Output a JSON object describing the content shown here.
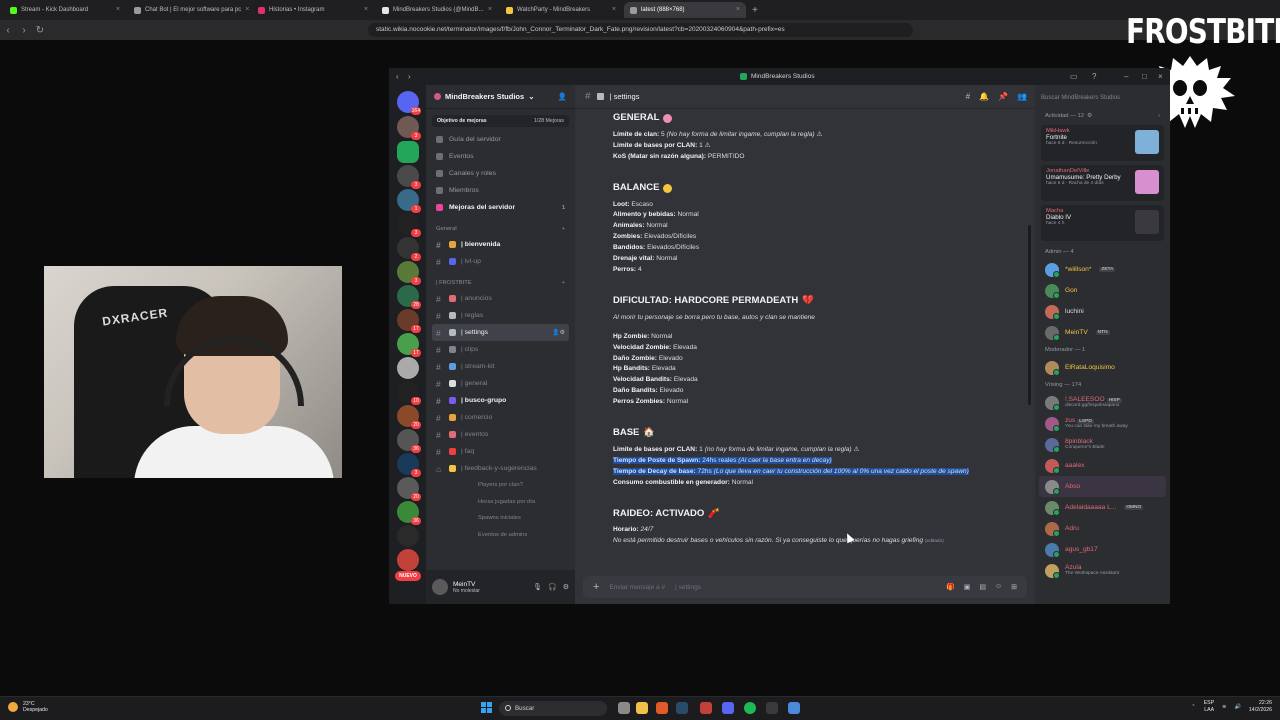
{
  "browser": {
    "tabs": [
      {
        "label": "Stream - Kick Dashboard",
        "color": "#53fc18"
      },
      {
        "label": "Chat Bot | El mejor software para pc",
        "color": "#9b9b9b"
      },
      {
        "label": "Historias • Instagram",
        "color": "#e1306c"
      },
      {
        "label": "MindBreakers Studios (@MindB...",
        "color": "#e6e6e6"
      },
      {
        "label": "WatchParty - MindBreakers",
        "color": "#f5c542"
      },
      {
        "label": "latest (888×768)",
        "color": "#9b9b9b"
      }
    ],
    "url": "static.wikia.nocookie.net/terminator/images/f/fb/John_Connor_Terminator_Dark_Fate.png/revision/latest?cb=20200324060904&path-prefix=es"
  },
  "overlay": {
    "brand": "FROSTBITE"
  },
  "webcam": {
    "chair_text": "DXRACER"
  },
  "discord": {
    "window_title": "MindBreakers Studios",
    "server_name": "MindBreakers Studios",
    "guild_badges": [
      "164",
      "3",
      "3",
      "1",
      "3",
      "2",
      "3",
      "28",
      "17",
      "17",
      "10",
      "20",
      "36",
      "3",
      "20",
      "36"
    ],
    "nuevo_label": "NUEVO",
    "boost": {
      "label": "Objetivo de mejoras",
      "value": "1/28 Mejoras"
    },
    "nav": [
      {
        "label": "Guía del servidor",
        "bold": false
      },
      {
        "label": "Eventos",
        "bold": false
      },
      {
        "label": "Canales y roles",
        "bold": false
      },
      {
        "label": "Miembros",
        "bold": false
      },
      {
        "label": "Mejoras del servidor",
        "bold": true,
        "count": "1"
      }
    ],
    "category_general": "General",
    "category_frostbite": "| FROSTBITE",
    "channels_general": [
      {
        "label": "| bienvenida",
        "unread": true,
        "emoji": "#e6a23c"
      },
      {
        "label": "| lvl-up",
        "unread": false,
        "emoji": "#5865f2"
      }
    ],
    "channels_frostbite": [
      {
        "label": "| anuncios",
        "unread": false,
        "emoji": "#e06c75"
      },
      {
        "label": "| reglas",
        "unread": false,
        "emoji": "#b5bac1"
      },
      {
        "label": "| settings",
        "unread": false,
        "active": true,
        "emoji": "#b5bac1"
      },
      {
        "label": "| clips",
        "unread": false,
        "emoji": "#80848e"
      },
      {
        "label": "| stream-kit",
        "unread": false,
        "emoji": "#5aa0e0"
      },
      {
        "label": "| general",
        "unread": false,
        "emoji": "#dbdee1"
      },
      {
        "label": "| busco-grupo",
        "unread": true,
        "emoji": "#7a5af0"
      },
      {
        "label": "| comercio",
        "unread": false,
        "emoji": "#e6a23c"
      },
      {
        "label": "| eventos",
        "unread": false,
        "emoji": "#e06c75"
      },
      {
        "label": "| faq",
        "unread": false,
        "emoji": "#f23f43"
      },
      {
        "label": "| feedback-y-sugerencias",
        "unread": false,
        "emoji": "#f5c542"
      }
    ],
    "threads": [
      "Players por clan?",
      "Horas jugadas por día",
      "Spawns iniciales",
      "Eventos de admins"
    ],
    "user": {
      "name": "MeinTV",
      "status": "No molestar"
    },
    "channel_header": "| settings",
    "composer_placeholder": "Enviar mensaje a #",
    "composer_channel": "| settings",
    "sections": {
      "general": {
        "title": "GENERAL",
        "lines": [
          {
            "label": "Límite de clan:",
            "value": "5",
            "note": "(No hay forma de limitar ingame, cumplan la regla)"
          },
          {
            "label": "Límite de bases por CLAN:",
            "value": "1"
          },
          {
            "label": "KoS (Matar sin razón alguna):",
            "value": "PERMITIDO"
          }
        ]
      },
      "balance": {
        "title": "BALANCE",
        "lines": [
          {
            "label": "Loot:",
            "value": "Escaso"
          },
          {
            "label": "Alimento y bebidas:",
            "value": "Normal"
          },
          {
            "label": "Animales:",
            "value": "Normal"
          },
          {
            "label": "Zombies:",
            "value": "Elevados/Difíciles"
          },
          {
            "label": "Bandidos:",
            "value": "Elevados/Difíciles"
          },
          {
            "label": "Drenaje vital:",
            "value": "Normal"
          },
          {
            "label": "Perros:",
            "value": "4"
          }
        ]
      },
      "dificultad": {
        "title": "DIFICULTAD: HARDCORE PERMADEATH",
        "subtitle": "Al morir tu personaje se borra pero tu base, autos y clan se mantiene",
        "lines": [
          {
            "label": "Hp Zombie:",
            "value": "Normal"
          },
          {
            "label": "Velocidad Zombie:",
            "value": "Elevada"
          },
          {
            "label": "Daño Zombie:",
            "value": "Elevado"
          },
          {
            "label": "Hp Bandits:",
            "value": "Elevada"
          },
          {
            "label": "Velocidad Bandits:",
            "value": "Elevada"
          },
          {
            "label": "Daño Bandits:",
            "value": "Elevado"
          },
          {
            "label": "Perros Zombies:",
            "value": "Normal"
          }
        ]
      },
      "base": {
        "title": "BASE",
        "lines": [
          {
            "label": "Limite de bases por CLAN:",
            "value": "1",
            "note": "(no hay forma de limitar ingame, cumplan la regla)"
          },
          {
            "label": "Tiempo de Poste de Spawn:",
            "value": "24hs reales",
            "note": "(Al caer la base entra en decay)",
            "selected": true
          },
          {
            "label": "Tiempo de Decay de base:",
            "value": "72hs",
            "note": "(Lo que lleva en caer tu construcción del 100% al 0% una vez caido el poste de spawn)",
            "selected": true
          },
          {
            "label": "Consumo combustible en generador:",
            "value": "Normal"
          }
        ]
      },
      "raideo": {
        "title": "RAIDEO: ACTIVADO",
        "lines": [
          {
            "label": "Horario:",
            "value": "24/7"
          }
        ],
        "note": "No está permitido destruir bases o vehículos sin razón. Si ya conseguiste lo que querías no hagas griefing",
        "edited": "(editado)"
      }
    },
    "members": {
      "search_placeholder": "Buscar MindBreakers Studios",
      "activity_header": "Actividad — 12",
      "activities": [
        {
          "name": "MikHawk",
          "game": "Fortnite",
          "status": "hace 6 d · Resurrección",
          "thumb": "#7fb0d8"
        },
        {
          "name": "JonathanDelVille",
          "game": "Umamusume: Pretty Derby",
          "status": "hace 6 d · Racha de 4 días",
          "thumb": "#d88fd0"
        },
        {
          "name": "Macha",
          "game": "Diablo IV",
          "status": "hace 4 h",
          "thumb": "#3a3a3e"
        }
      ],
      "groups": [
        {
          "header": "Admin — 4",
          "items": [
            {
              "name": "*wiillson*",
              "tag": "ZETA",
              "color": "#f5c542",
              "ava": "#5aa0e0"
            },
            {
              "name": "Gon",
              "color": "#f5c542",
              "ava": "#4a8a5a"
            },
            {
              "name": "luchini",
              "color": "#dbdee1",
              "ava": "#c26a5a"
            },
            {
              "name": "MeinTV",
              "tag": "NTN",
              "color": "#f5c542",
              "ava": "#6a6a6a"
            }
          ]
        },
        {
          "header": "Moderador — 1",
          "items": [
            {
              "name": "ElRataLoquisimo",
              "color": "#f5c542",
              "ava": "#b08a5a"
            }
          ]
        },
        {
          "header": "Vrising — 174",
          "items": [
            {
              "name": "!.SALEESOO",
              "tag": "HISP",
              "sub": "discord.gg/hispahsiapano",
              "color": "#e06c75",
              "ava": "#7a7a7a"
            },
            {
              "name": "zus",
              "tag": "LSPD",
              "sub": "You can take my breath away.",
              "color": "#e06c75",
              "ava": "#a05a8a"
            },
            {
              "name": "8pinblack",
              "sub": "Conqueror's Blade",
              "color": "#e06c75",
              "ava": "#5a6a9a"
            },
            {
              "name": "aaalex",
              "color": "#e06c75",
              "ava": "#c25a5a"
            },
            {
              "name": "Abso",
              "color": "#e06c75",
              "ava": "#8a8a8a",
              "highlight": true
            },
            {
              "name": "Adelaidaaaaa L...",
              "tag": "OMNO",
              "color": "#e06c75",
              "ava": "#6a8a6a"
            },
            {
              "name": "Adru",
              "color": "#e06c75",
              "ava": "#aa6a4a"
            },
            {
              "name": "agus_gb17",
              "color": "#e06c75",
              "ava": "#4a7aaa"
            },
            {
              "name": "Azula",
              "sub": "The Workspace Assistant",
              "color": "#e06c75",
              "ava": "#c0a060"
            }
          ]
        }
      ]
    }
  },
  "taskbar": {
    "weather_temp": "23°C",
    "weather_desc": "Despejado",
    "search_label": "Buscar",
    "lang": "ESP",
    "lang2": "LAA",
    "time": "22:26",
    "date": "14/2/2026"
  }
}
